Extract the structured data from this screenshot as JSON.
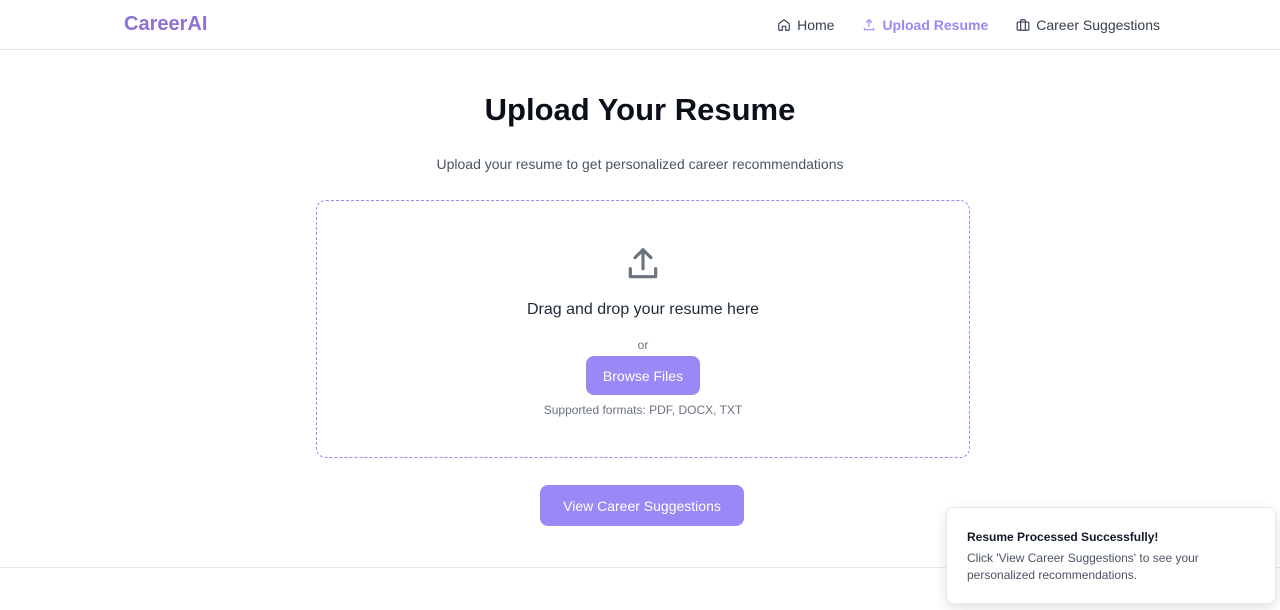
{
  "brand": "CareerAI",
  "nav": [
    {
      "label": "Home",
      "icon": "home-icon"
    },
    {
      "label": "Upload Resume",
      "icon": "upload-icon",
      "active": true
    },
    {
      "label": "Career Suggestions",
      "icon": "briefcase-icon"
    }
  ],
  "page": {
    "title": "Upload Your Resume",
    "subtitle": "Upload your resume to get personalized career recommendations"
  },
  "dropzone": {
    "text": "Drag and drop your resume here",
    "or": "or",
    "browse": "Browse Files",
    "formats": "Supported formats: PDF, DOCX, TXT"
  },
  "view_button": "View Career Suggestions",
  "toast": {
    "title": "Resume Processed Successfully!",
    "description": "Click 'View Career Suggestions' to see your personalized recommendations."
  },
  "colors": {
    "accent": "#9b87f5",
    "brand": "#8b72d6"
  }
}
